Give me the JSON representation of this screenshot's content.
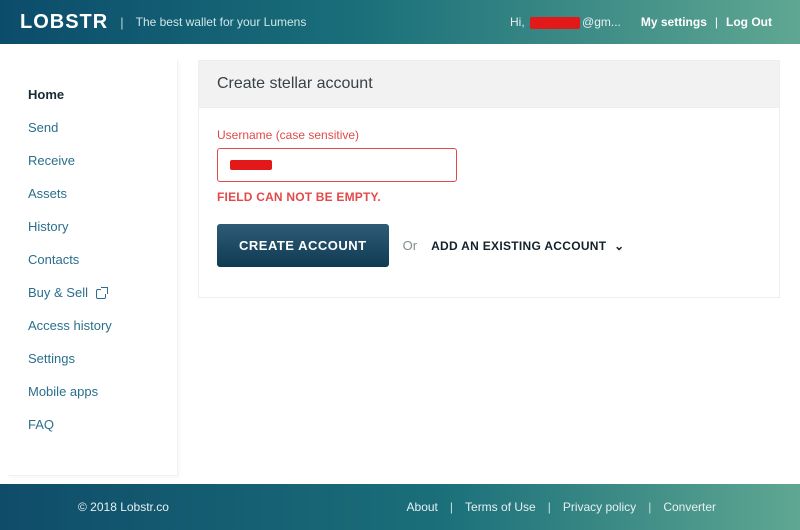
{
  "header": {
    "logo": "LOBSTR",
    "tagline": "The best wallet for your Lumens",
    "greeting_prefix": "Hi,",
    "greeting_suffix": "@gm...",
    "my_settings": "My settings",
    "logout": "Log Out"
  },
  "sidebar": {
    "items": [
      {
        "label": "Home",
        "active": true
      },
      {
        "label": "Send"
      },
      {
        "label": "Receive"
      },
      {
        "label": "Assets"
      },
      {
        "label": "History"
      },
      {
        "label": "Contacts"
      },
      {
        "label": "Buy & Sell",
        "external": true
      },
      {
        "label": "Access history"
      },
      {
        "label": "Settings"
      },
      {
        "label": "Mobile apps"
      },
      {
        "label": "FAQ"
      }
    ]
  },
  "main": {
    "title": "Create stellar account",
    "username_label": "Username (case sensitive)",
    "username_value": "",
    "error": "FIELD CAN NOT BE EMPTY.",
    "create_btn": "CREATE ACCOUNT",
    "or": "Or",
    "add_existing": "ADD AN EXISTING ACCOUNT"
  },
  "footer": {
    "copyright": "© 2018 Lobstr.co",
    "links": [
      "About",
      "Terms of Use",
      "Privacy policy",
      "Converter"
    ]
  }
}
